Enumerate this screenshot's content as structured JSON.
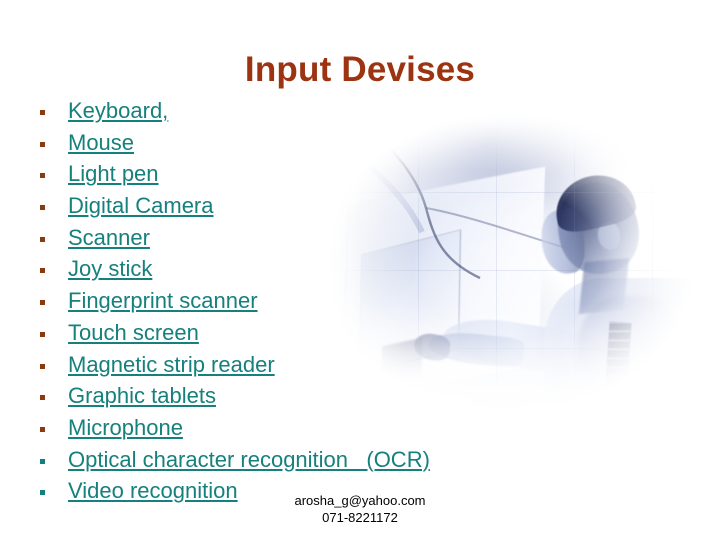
{
  "slide": {
    "title": "Input Devises",
    "title_color": "#9c3412",
    "text_color": "#16807d",
    "bullet_color": "#8b3a10",
    "background_color": "#ffffff"
  },
  "bullets": [
    {
      "label": "Keyboard,"
    },
    {
      "label": "Mouse"
    },
    {
      "label": "Light pen"
    },
    {
      "label": "Digital Camera"
    },
    {
      "label": "Scanner"
    },
    {
      "label": "Joy stick"
    },
    {
      "label": "Fingerprint scanner"
    },
    {
      "label": "Touch screen"
    },
    {
      "label": "Magnetic strip reader"
    },
    {
      "label": "Graphic tablets"
    },
    {
      "label": "Microphone"
    },
    {
      "label": "Optical character recognition   (OCR)"
    },
    {
      "label": "Video recognition"
    }
  ],
  "footer": {
    "email": "arosha_g@yahoo.com",
    "phone": "071-8221172"
  },
  "photo": {
    "alt": "faded blue-tinted photo of a man touching a touch-screen monitor"
  }
}
